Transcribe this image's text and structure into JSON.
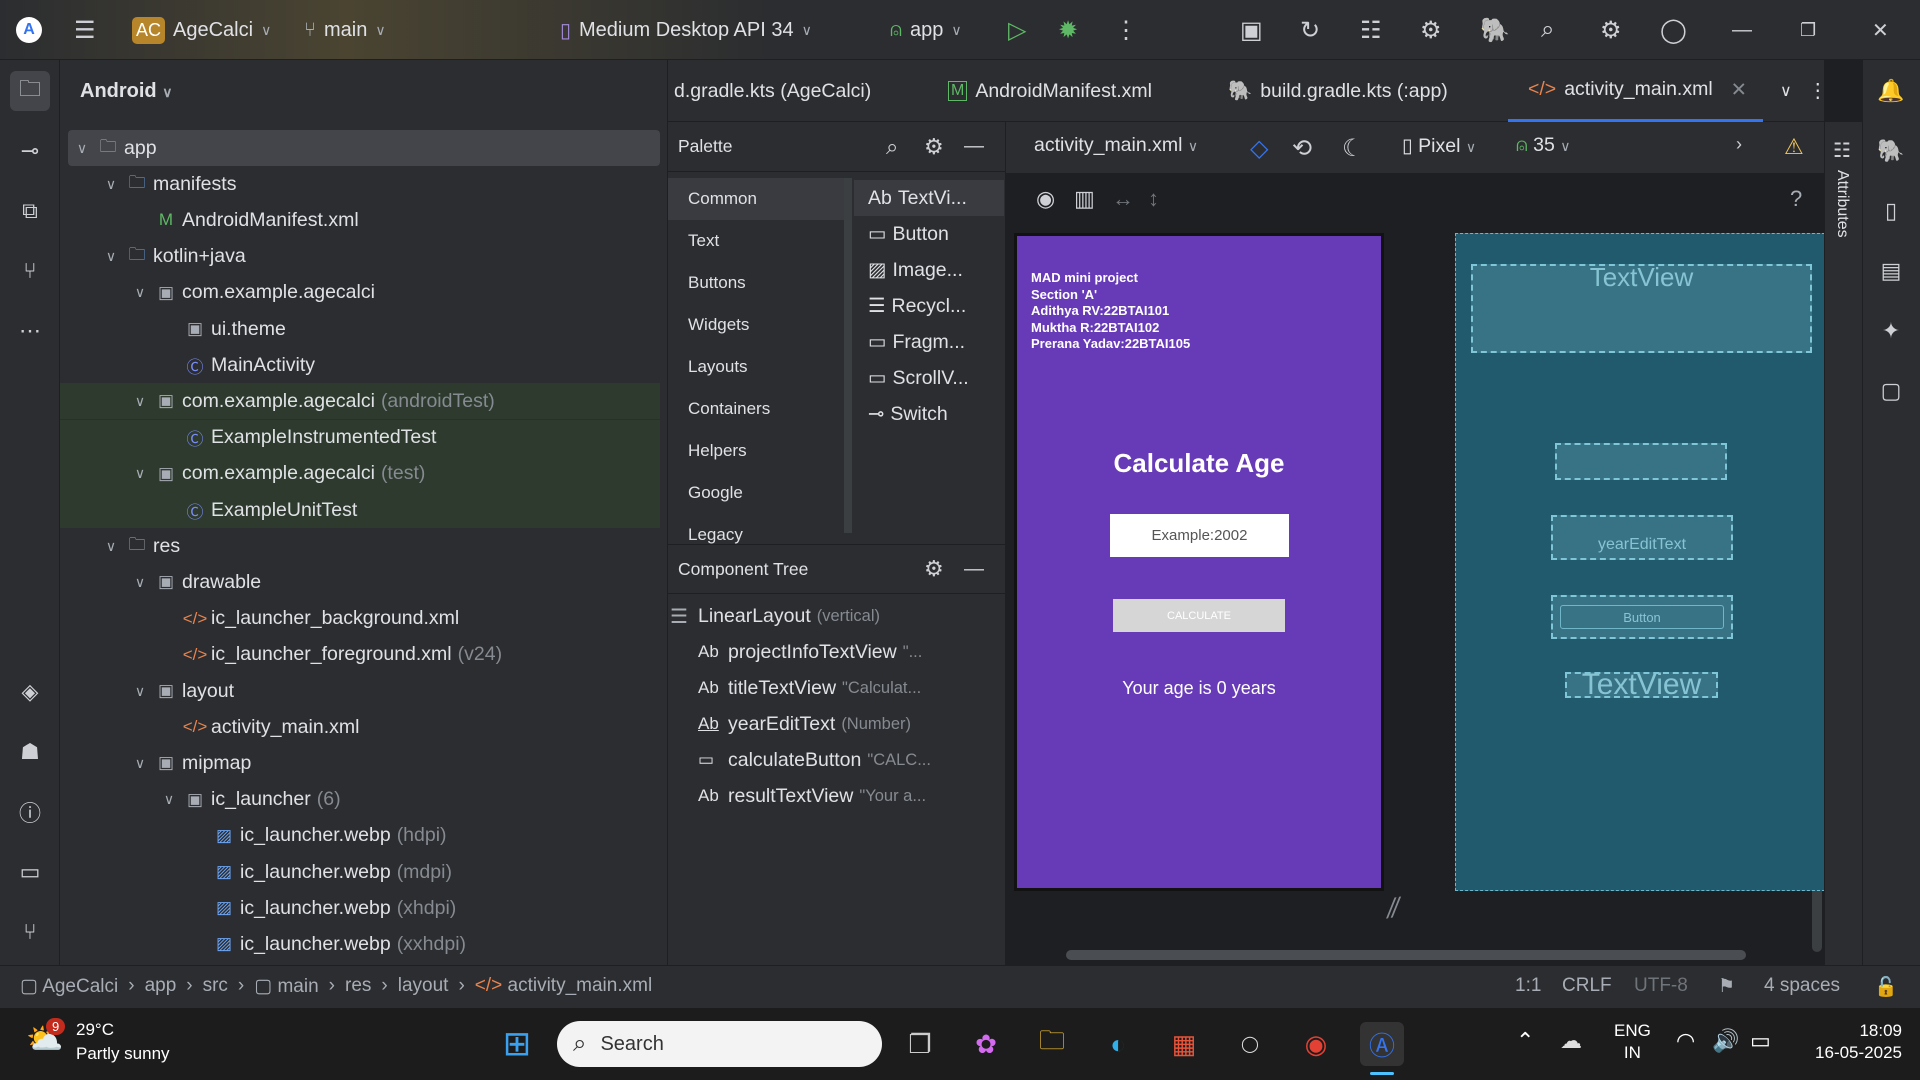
{
  "topbar": {
    "project_badge": "AC",
    "project": "AgeCalci",
    "branch": "main",
    "device": "Medium Desktop API 34",
    "run_config": "app"
  },
  "project_panel": {
    "view": "Android",
    "tree": [
      {
        "label": "app",
        "level": 0,
        "icon": "module-folder-icon",
        "open": true,
        "selected": true
      },
      {
        "label": "manifests",
        "level": 1,
        "icon": "folder-icon",
        "open": true
      },
      {
        "label": "AndroidManifest.xml",
        "level": 2,
        "icon": "manifest-icon"
      },
      {
        "label": "kotlin+java",
        "level": 1,
        "icon": "folder-icon",
        "open": true
      },
      {
        "label": "com.example.agecalci",
        "level": 2,
        "icon": "package-icon",
        "open": true
      },
      {
        "label": "ui.theme",
        "level": 3,
        "icon": "package-icon"
      },
      {
        "label": "MainActivity",
        "level": 3,
        "icon": "kotlin-class-icon"
      },
      {
        "label": "com.example.agecalci",
        "sub": "(androidTest)",
        "level": 2,
        "icon": "package-icon",
        "open": true,
        "test": true
      },
      {
        "label": "ExampleInstrumentedTest",
        "level": 3,
        "icon": "kotlin-class-icon",
        "test": true
      },
      {
        "label": "com.example.agecalci",
        "sub": "(test)",
        "level": 2,
        "icon": "package-icon",
        "open": true,
        "test": true
      },
      {
        "label": "ExampleUnitTest",
        "level": 3,
        "icon": "kotlin-class-icon",
        "test": true
      },
      {
        "label": "res",
        "level": 1,
        "icon": "res-folder-icon",
        "open": true
      },
      {
        "label": "drawable",
        "level": 2,
        "icon": "package-icon",
        "open": true
      },
      {
        "label": "ic_launcher_background.xml",
        "level": 3,
        "icon": "xml-icon"
      },
      {
        "label": "ic_launcher_foreground.xml",
        "sub": "(v24)",
        "level": 3,
        "icon": "xml-icon"
      },
      {
        "label": "layout",
        "level": 2,
        "icon": "package-icon",
        "open": true
      },
      {
        "label": "activity_main.xml",
        "level": 3,
        "icon": "xml-icon"
      },
      {
        "label": "mipmap",
        "level": 2,
        "icon": "package-icon",
        "open": true
      },
      {
        "label": "ic_launcher",
        "sub": "(6)",
        "level": 3,
        "icon": "package-icon",
        "open": true
      },
      {
        "label": "ic_launcher.webp",
        "sub": "(hdpi)",
        "level": 4,
        "icon": "image-icon"
      },
      {
        "label": "ic_launcher.webp",
        "sub": "(mdpi)",
        "level": 4,
        "icon": "image-icon"
      },
      {
        "label": "ic_launcher.webp",
        "sub": "(xhdpi)",
        "level": 4,
        "icon": "image-icon"
      },
      {
        "label": "ic_launcher.webp",
        "sub": "(xxhdpi)",
        "level": 4,
        "icon": "image-icon"
      }
    ]
  },
  "tabs": [
    {
      "label": "d.gradle.kts (AgeCalci)"
    },
    {
      "label": "AndroidManifest.xml"
    },
    {
      "label": "build.gradle.kts (:app)"
    },
    {
      "label": "activity_main.xml",
      "active": true
    }
  ],
  "palette": {
    "title": "Palette",
    "categories": [
      "Common",
      "Text",
      "Buttons",
      "Widgets",
      "Layouts",
      "Containers",
      "Helpers",
      "Google",
      "Legacy"
    ],
    "items": [
      {
        "icon": "Ab",
        "label": "TextVi..."
      },
      {
        "icon": "▭",
        "label": "Button"
      },
      {
        "icon": "▨",
        "label": "Image..."
      },
      {
        "icon": "☰",
        "label": "Recycl..."
      },
      {
        "icon": "▭",
        "label": "Fragm..."
      },
      {
        "icon": "▭",
        "label": "ScrollV..."
      },
      {
        "icon": "⊸",
        "label": "Switch"
      }
    ]
  },
  "component_tree": {
    "title": "Component Tree",
    "root": {
      "label": "LinearLayout",
      "sub": "(vertical)"
    },
    "children": [
      {
        "icon": "Ab",
        "label": "projectInfoTextView",
        "sub": "\"..."
      },
      {
        "icon": "Ab",
        "label": "titleTextView",
        "sub": "\"Calculat..."
      },
      {
        "icon": "Ab",
        "label": "yearEditText",
        "sub": "(Number)"
      },
      {
        "icon": "▭",
        "label": "calculateButton",
        "sub": "\"CALC..."
      },
      {
        "icon": "Ab",
        "label": "resultTextView",
        "sub": "\"Your a..."
      }
    ]
  },
  "design_toolbar": {
    "file": "activity_main.xml",
    "device": "Pixel",
    "api": "35"
  },
  "attributes_label": "Attributes",
  "preview": {
    "info_lines": [
      "MAD mini project",
      "Section 'A'",
      "Adithya RV:22BTAI101",
      "Muktha R:22BTAI102",
      "Prerana Yadav:22BTAI105"
    ],
    "title": "Calculate Age",
    "input_hint": "Example:2002",
    "button": "CALCULATE",
    "result": "Your age is 0 years"
  },
  "blueprint": {
    "textview1": "TextView",
    "edit": "yearEditText",
    "button": "Button",
    "textview2": "TextView"
  },
  "statusbar": {
    "breadcrumbs": [
      "AgeCalci",
      "app",
      "src",
      "main",
      "res",
      "layout",
      "activity_main.xml"
    ],
    "position": "1:1",
    "line_sep": "CRLF",
    "encoding": "UTF-8",
    "indent": "4 spaces"
  },
  "taskbar": {
    "weather_badge": "9",
    "temp": "29°C",
    "weather": "Partly sunny",
    "search": "Search",
    "lang1": "ENG",
    "lang2": "IN",
    "time": "18:09",
    "date": "16-05-2025"
  },
  "colors": {
    "accent": "#3574f0",
    "preview_bg": "#673ab7",
    "blueprint_bg": "#215a6d",
    "warning": "#f2c55c"
  }
}
